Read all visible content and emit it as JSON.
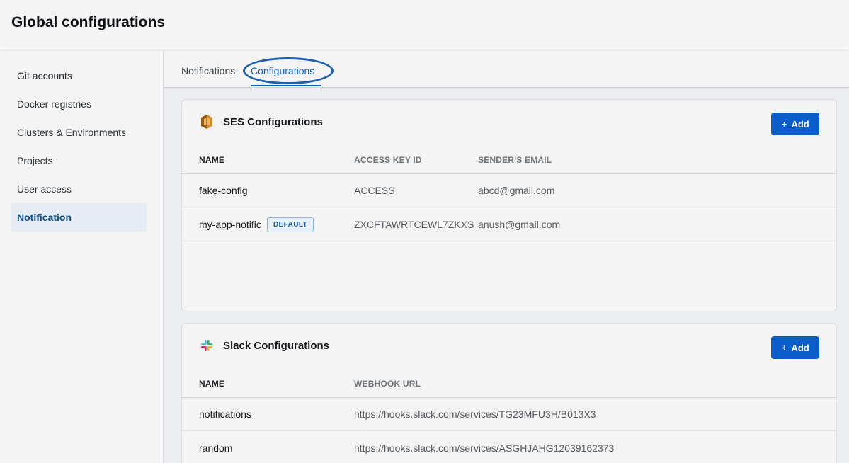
{
  "header": {
    "title": "Global configurations"
  },
  "sidebar": {
    "items": [
      {
        "label": "Git accounts",
        "active": false
      },
      {
        "label": "Docker registries",
        "active": false
      },
      {
        "label": "Clusters & Environments",
        "active": false
      },
      {
        "label": "Projects",
        "active": false
      },
      {
        "label": "User access",
        "active": false
      },
      {
        "label": "Notification",
        "active": true
      }
    ]
  },
  "tabs": [
    {
      "label": "Notifications",
      "active": false
    },
    {
      "label": "Configurations",
      "active": true
    }
  ],
  "ses": {
    "title": "SES Configurations",
    "icon": "aws-ses-icon",
    "add_label": "Add",
    "columns": [
      "NAME",
      "ACCESS KEY ID",
      "SENDER'S EMAIL"
    ],
    "rows": [
      {
        "name": "fake-config",
        "access_key": "ACCESS",
        "email": "abcd@gmail.com",
        "badge": ""
      },
      {
        "name": "my-app-notific",
        "access_key": "ZXCFTAWRTCEWL7ZKXS",
        "email": "anush@gmail.com",
        "badge": "DEFAULT"
      }
    ]
  },
  "slack": {
    "title": "Slack Configurations",
    "icon": "slack-icon",
    "add_label": "Add",
    "columns": [
      "NAME",
      "WEBHOOK URL"
    ],
    "rows": [
      {
        "name": "notifications",
        "url": "https://hooks.slack.com/services/TG23MFU3H/B013X3"
      },
      {
        "name": "random",
        "url": "https://hooks.slack.com/services/ASGHJAHG12039162373"
      }
    ]
  },
  "colors": {
    "accent": "#0b5ec9",
    "active_nav_bg": "#e6ecf3",
    "highlight_circle": "#1a5fb0"
  }
}
